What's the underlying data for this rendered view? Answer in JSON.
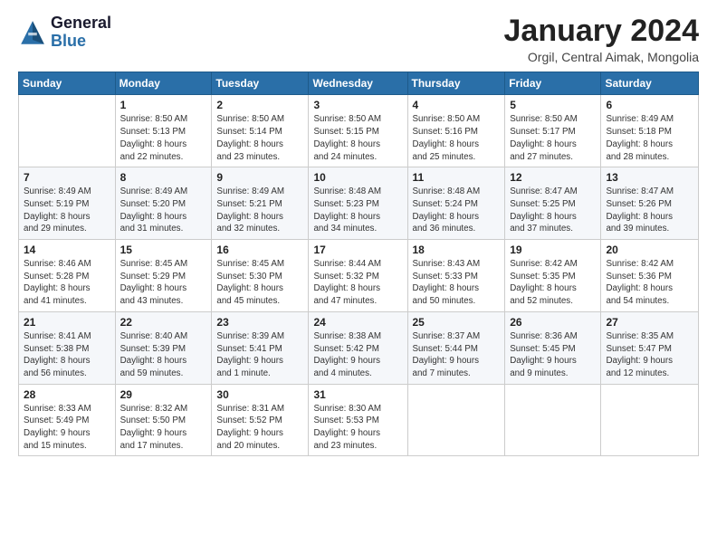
{
  "logo": {
    "line1": "General",
    "line2": "Blue"
  },
  "title": "January 2024",
  "subtitle": "Orgil, Central Aimak, Mongolia",
  "days_of_week": [
    "Sunday",
    "Monday",
    "Tuesday",
    "Wednesday",
    "Thursday",
    "Friday",
    "Saturday"
  ],
  "weeks": [
    [
      {
        "day": "",
        "info": ""
      },
      {
        "day": "1",
        "info": "Sunrise: 8:50 AM\nSunset: 5:13 PM\nDaylight: 8 hours\nand 22 minutes."
      },
      {
        "day": "2",
        "info": "Sunrise: 8:50 AM\nSunset: 5:14 PM\nDaylight: 8 hours\nand 23 minutes."
      },
      {
        "day": "3",
        "info": "Sunrise: 8:50 AM\nSunset: 5:15 PM\nDaylight: 8 hours\nand 24 minutes."
      },
      {
        "day": "4",
        "info": "Sunrise: 8:50 AM\nSunset: 5:16 PM\nDaylight: 8 hours\nand 25 minutes."
      },
      {
        "day": "5",
        "info": "Sunrise: 8:50 AM\nSunset: 5:17 PM\nDaylight: 8 hours\nand 27 minutes."
      },
      {
        "day": "6",
        "info": "Sunrise: 8:49 AM\nSunset: 5:18 PM\nDaylight: 8 hours\nand 28 minutes."
      }
    ],
    [
      {
        "day": "7",
        "info": "Sunrise: 8:49 AM\nSunset: 5:19 PM\nDaylight: 8 hours\nand 29 minutes."
      },
      {
        "day": "8",
        "info": "Sunrise: 8:49 AM\nSunset: 5:20 PM\nDaylight: 8 hours\nand 31 minutes."
      },
      {
        "day": "9",
        "info": "Sunrise: 8:49 AM\nSunset: 5:21 PM\nDaylight: 8 hours\nand 32 minutes."
      },
      {
        "day": "10",
        "info": "Sunrise: 8:48 AM\nSunset: 5:23 PM\nDaylight: 8 hours\nand 34 minutes."
      },
      {
        "day": "11",
        "info": "Sunrise: 8:48 AM\nSunset: 5:24 PM\nDaylight: 8 hours\nand 36 minutes."
      },
      {
        "day": "12",
        "info": "Sunrise: 8:47 AM\nSunset: 5:25 PM\nDaylight: 8 hours\nand 37 minutes."
      },
      {
        "day": "13",
        "info": "Sunrise: 8:47 AM\nSunset: 5:26 PM\nDaylight: 8 hours\nand 39 minutes."
      }
    ],
    [
      {
        "day": "14",
        "info": "Sunrise: 8:46 AM\nSunset: 5:28 PM\nDaylight: 8 hours\nand 41 minutes."
      },
      {
        "day": "15",
        "info": "Sunrise: 8:45 AM\nSunset: 5:29 PM\nDaylight: 8 hours\nand 43 minutes."
      },
      {
        "day": "16",
        "info": "Sunrise: 8:45 AM\nSunset: 5:30 PM\nDaylight: 8 hours\nand 45 minutes."
      },
      {
        "day": "17",
        "info": "Sunrise: 8:44 AM\nSunset: 5:32 PM\nDaylight: 8 hours\nand 47 minutes."
      },
      {
        "day": "18",
        "info": "Sunrise: 8:43 AM\nSunset: 5:33 PM\nDaylight: 8 hours\nand 50 minutes."
      },
      {
        "day": "19",
        "info": "Sunrise: 8:42 AM\nSunset: 5:35 PM\nDaylight: 8 hours\nand 52 minutes."
      },
      {
        "day": "20",
        "info": "Sunrise: 8:42 AM\nSunset: 5:36 PM\nDaylight: 8 hours\nand 54 minutes."
      }
    ],
    [
      {
        "day": "21",
        "info": "Sunrise: 8:41 AM\nSunset: 5:38 PM\nDaylight: 8 hours\nand 56 minutes."
      },
      {
        "day": "22",
        "info": "Sunrise: 8:40 AM\nSunset: 5:39 PM\nDaylight: 8 hours\nand 59 minutes."
      },
      {
        "day": "23",
        "info": "Sunrise: 8:39 AM\nSunset: 5:41 PM\nDaylight: 9 hours\nand 1 minute."
      },
      {
        "day": "24",
        "info": "Sunrise: 8:38 AM\nSunset: 5:42 PM\nDaylight: 9 hours\nand 4 minutes."
      },
      {
        "day": "25",
        "info": "Sunrise: 8:37 AM\nSunset: 5:44 PM\nDaylight: 9 hours\nand 7 minutes."
      },
      {
        "day": "26",
        "info": "Sunrise: 8:36 AM\nSunset: 5:45 PM\nDaylight: 9 hours\nand 9 minutes."
      },
      {
        "day": "27",
        "info": "Sunrise: 8:35 AM\nSunset: 5:47 PM\nDaylight: 9 hours\nand 12 minutes."
      }
    ],
    [
      {
        "day": "28",
        "info": "Sunrise: 8:33 AM\nSunset: 5:49 PM\nDaylight: 9 hours\nand 15 minutes."
      },
      {
        "day": "29",
        "info": "Sunrise: 8:32 AM\nSunset: 5:50 PM\nDaylight: 9 hours\nand 17 minutes."
      },
      {
        "day": "30",
        "info": "Sunrise: 8:31 AM\nSunset: 5:52 PM\nDaylight: 9 hours\nand 20 minutes."
      },
      {
        "day": "31",
        "info": "Sunrise: 8:30 AM\nSunset: 5:53 PM\nDaylight: 9 hours\nand 23 minutes."
      },
      {
        "day": "",
        "info": ""
      },
      {
        "day": "",
        "info": ""
      },
      {
        "day": "",
        "info": ""
      }
    ]
  ]
}
